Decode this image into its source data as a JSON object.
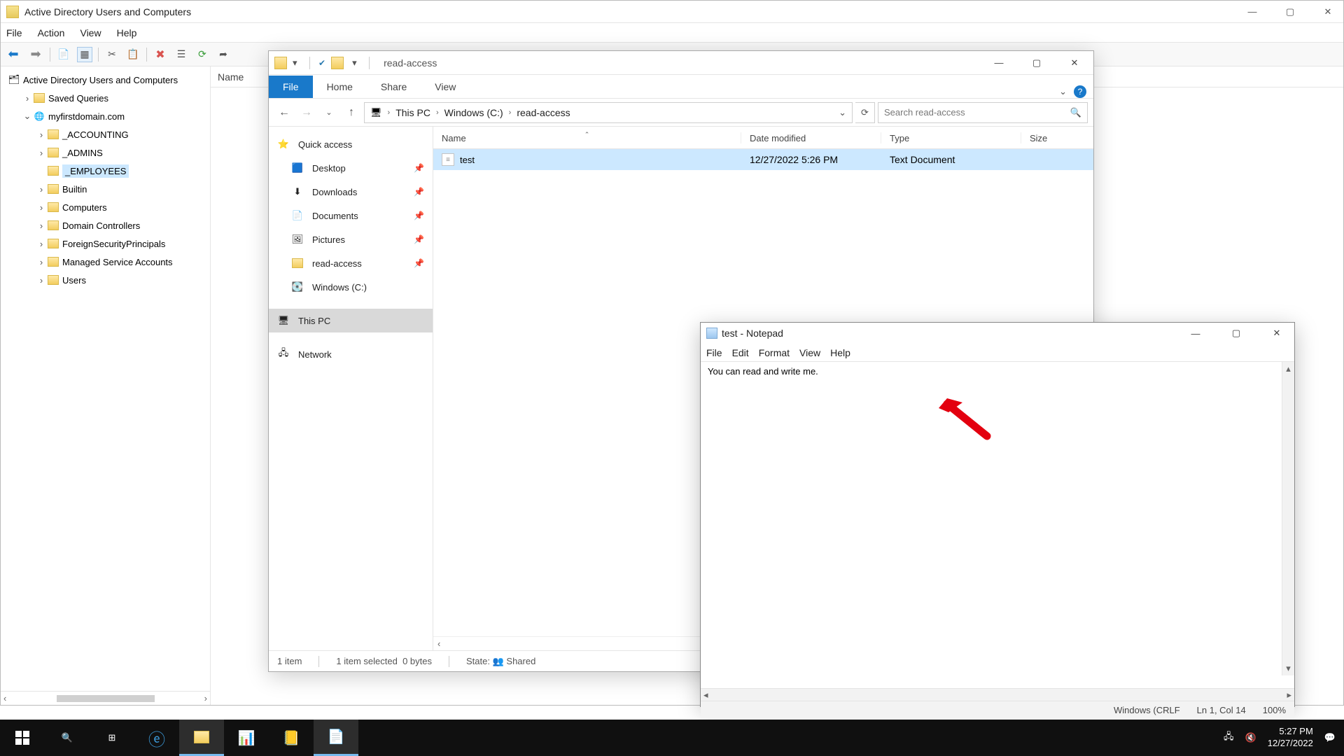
{
  "ad_window": {
    "title": "Active Directory Users and Computers",
    "menubar": [
      "File",
      "Action",
      "View",
      "Help"
    ],
    "tree": {
      "root": "Active Directory Users and Computers",
      "items": [
        {
          "label": "Saved Queries",
          "depth": 1,
          "expandable": true,
          "expanded": false,
          "icon": "folder"
        },
        {
          "label": "myfirstdomain.com",
          "depth": 1,
          "expandable": true,
          "expanded": true,
          "icon": "domain"
        },
        {
          "label": "_ACCOUNTING",
          "depth": 2,
          "expandable": true,
          "expanded": false,
          "icon": "folder"
        },
        {
          "label": "_ADMINS",
          "depth": 2,
          "expandable": true,
          "expanded": false,
          "icon": "folder"
        },
        {
          "label": "_EMPLOYEES",
          "depth": 2,
          "expandable": false,
          "expanded": false,
          "icon": "folder",
          "selected": true
        },
        {
          "label": "Builtin",
          "depth": 2,
          "expandable": true,
          "expanded": false,
          "icon": "folder"
        },
        {
          "label": "Computers",
          "depth": 2,
          "expandable": true,
          "expanded": false,
          "icon": "folder"
        },
        {
          "label": "Domain Controllers",
          "depth": 2,
          "expandable": true,
          "expanded": false,
          "icon": "folder"
        },
        {
          "label": "ForeignSecurityPrincipals",
          "depth": 2,
          "expandable": true,
          "expanded": false,
          "icon": "folder"
        },
        {
          "label": "Managed Service Accounts",
          "depth": 2,
          "expandable": true,
          "expanded": false,
          "icon": "folder"
        },
        {
          "label": "Users",
          "depth": 2,
          "expandable": true,
          "expanded": false,
          "icon": "folder"
        }
      ]
    },
    "list_header": "Name"
  },
  "explorer": {
    "title_path_text": "read-access",
    "ribbon_tabs": [
      "File",
      "Home",
      "Share",
      "View"
    ],
    "breadcrumb": [
      "This PC",
      "Windows (C:)",
      "read-access"
    ],
    "search_placeholder": "Search read-access",
    "nav_items": [
      {
        "label": "Quick access",
        "indent": false,
        "icon": "star",
        "pin": false,
        "selected": false
      },
      {
        "label": "Desktop",
        "indent": true,
        "icon": "desktop",
        "pin": true,
        "selected": false
      },
      {
        "label": "Downloads",
        "indent": true,
        "icon": "download",
        "pin": true,
        "selected": false
      },
      {
        "label": "Documents",
        "indent": true,
        "icon": "document",
        "pin": true,
        "selected": false
      },
      {
        "label": "Pictures",
        "indent": true,
        "icon": "picture",
        "pin": true,
        "selected": false
      },
      {
        "label": "read-access",
        "indent": true,
        "icon": "folder",
        "pin": true,
        "selected": false
      },
      {
        "label": "Windows (C:)",
        "indent": true,
        "icon": "drive",
        "pin": false,
        "selected": false
      },
      {
        "label": "This PC",
        "indent": false,
        "icon": "pc",
        "pin": false,
        "selected": true
      },
      {
        "label": "Network",
        "indent": false,
        "icon": "network",
        "pin": false,
        "selected": false
      }
    ],
    "columns": {
      "name": "Name",
      "date": "Date modified",
      "type": "Type",
      "size": "Size"
    },
    "rows": [
      {
        "name": "test",
        "date": "12/27/2022 5:26 PM",
        "type": "Text Document",
        "size": ""
      }
    ],
    "status": {
      "count": "1 item",
      "selected": "1 item selected",
      "bytes": "0 bytes",
      "state_label": "State:",
      "state_value": "Shared"
    }
  },
  "notepad": {
    "title": "test - Notepad",
    "menubar": [
      "File",
      "Edit",
      "Format",
      "View",
      "Help"
    ],
    "content": "You can read and write me.",
    "status": {
      "encoding": "Windows (CRLF",
      "position": "Ln 1, Col 14",
      "zoom": "100%"
    }
  },
  "taskbar": {
    "clock_time": "5:27 PM",
    "clock_date": "12/27/2022"
  }
}
